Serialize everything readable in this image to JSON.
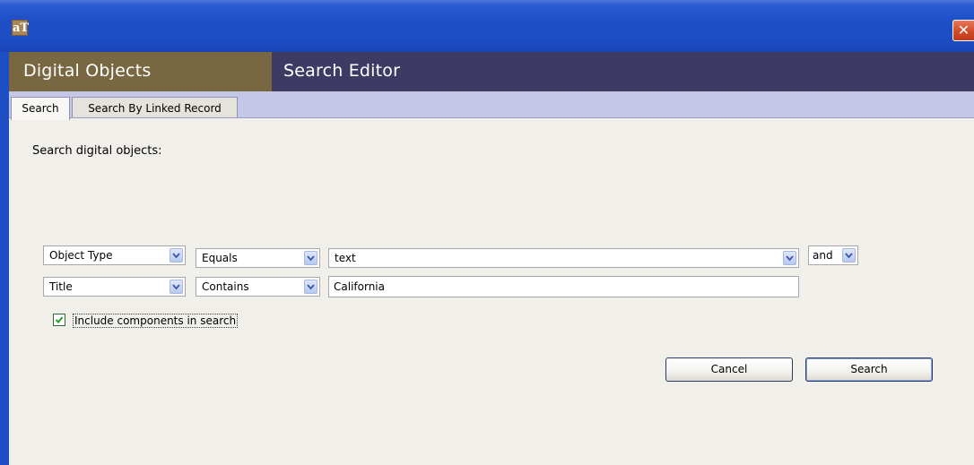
{
  "window": {
    "icon_label": "aT",
    "close_symbol": "✕"
  },
  "header": {
    "module_title": "Digital Objects",
    "editor_title": "Search Editor"
  },
  "tabs": [
    {
      "label": "Search",
      "active": true
    },
    {
      "label": "Search By Linked Record",
      "active": false
    }
  ],
  "search": {
    "prompt": "Search digital objects:",
    "rows": [
      {
        "field": "Object Type",
        "operator": "Equals",
        "value": "text",
        "connector": "and"
      },
      {
        "field": "Title",
        "operator": "Contains",
        "value": "California"
      }
    ],
    "include_components": {
      "label": "Include components in search",
      "checked": true
    }
  },
  "buttons": {
    "cancel": "Cancel",
    "search": "Search"
  }
}
